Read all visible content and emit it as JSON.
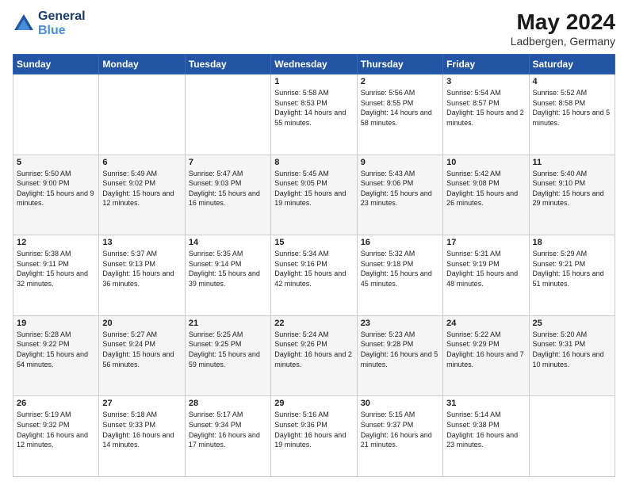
{
  "logo": {
    "line1": "General",
    "line2": "Blue"
  },
  "title": "May 2024",
  "location": "Ladbergen, Germany",
  "days_header": [
    "Sunday",
    "Monday",
    "Tuesday",
    "Wednesday",
    "Thursday",
    "Friday",
    "Saturday"
  ],
  "weeks": [
    [
      {
        "day": "",
        "sunrise": "",
        "sunset": "",
        "daylight": ""
      },
      {
        "day": "",
        "sunrise": "",
        "sunset": "",
        "daylight": ""
      },
      {
        "day": "",
        "sunrise": "",
        "sunset": "",
        "daylight": ""
      },
      {
        "day": "1",
        "sunrise": "Sunrise: 5:58 AM",
        "sunset": "Sunset: 8:53 PM",
        "daylight": "Daylight: 14 hours and 55 minutes."
      },
      {
        "day": "2",
        "sunrise": "Sunrise: 5:56 AM",
        "sunset": "Sunset: 8:55 PM",
        "daylight": "Daylight: 14 hours and 58 minutes."
      },
      {
        "day": "3",
        "sunrise": "Sunrise: 5:54 AM",
        "sunset": "Sunset: 8:57 PM",
        "daylight": "Daylight: 15 hours and 2 minutes."
      },
      {
        "day": "4",
        "sunrise": "Sunrise: 5:52 AM",
        "sunset": "Sunset: 8:58 PM",
        "daylight": "Daylight: 15 hours and 5 minutes."
      }
    ],
    [
      {
        "day": "5",
        "sunrise": "Sunrise: 5:50 AM",
        "sunset": "Sunset: 9:00 PM",
        "daylight": "Daylight: 15 hours and 9 minutes."
      },
      {
        "day": "6",
        "sunrise": "Sunrise: 5:49 AM",
        "sunset": "Sunset: 9:02 PM",
        "daylight": "Daylight: 15 hours and 12 minutes."
      },
      {
        "day": "7",
        "sunrise": "Sunrise: 5:47 AM",
        "sunset": "Sunset: 9:03 PM",
        "daylight": "Daylight: 15 hours and 16 minutes."
      },
      {
        "day": "8",
        "sunrise": "Sunrise: 5:45 AM",
        "sunset": "Sunset: 9:05 PM",
        "daylight": "Daylight: 15 hours and 19 minutes."
      },
      {
        "day": "9",
        "sunrise": "Sunrise: 5:43 AM",
        "sunset": "Sunset: 9:06 PM",
        "daylight": "Daylight: 15 hours and 23 minutes."
      },
      {
        "day": "10",
        "sunrise": "Sunrise: 5:42 AM",
        "sunset": "Sunset: 9:08 PM",
        "daylight": "Daylight: 15 hours and 26 minutes."
      },
      {
        "day": "11",
        "sunrise": "Sunrise: 5:40 AM",
        "sunset": "Sunset: 9:10 PM",
        "daylight": "Daylight: 15 hours and 29 minutes."
      }
    ],
    [
      {
        "day": "12",
        "sunrise": "Sunrise: 5:38 AM",
        "sunset": "Sunset: 9:11 PM",
        "daylight": "Daylight: 15 hours and 32 minutes."
      },
      {
        "day": "13",
        "sunrise": "Sunrise: 5:37 AM",
        "sunset": "Sunset: 9:13 PM",
        "daylight": "Daylight: 15 hours and 36 minutes."
      },
      {
        "day": "14",
        "sunrise": "Sunrise: 5:35 AM",
        "sunset": "Sunset: 9:14 PM",
        "daylight": "Daylight: 15 hours and 39 minutes."
      },
      {
        "day": "15",
        "sunrise": "Sunrise: 5:34 AM",
        "sunset": "Sunset: 9:16 PM",
        "daylight": "Daylight: 15 hours and 42 minutes."
      },
      {
        "day": "16",
        "sunrise": "Sunrise: 5:32 AM",
        "sunset": "Sunset: 9:18 PM",
        "daylight": "Daylight: 15 hours and 45 minutes."
      },
      {
        "day": "17",
        "sunrise": "Sunrise: 5:31 AM",
        "sunset": "Sunset: 9:19 PM",
        "daylight": "Daylight: 15 hours and 48 minutes."
      },
      {
        "day": "18",
        "sunrise": "Sunrise: 5:29 AM",
        "sunset": "Sunset: 9:21 PM",
        "daylight": "Daylight: 15 hours and 51 minutes."
      }
    ],
    [
      {
        "day": "19",
        "sunrise": "Sunrise: 5:28 AM",
        "sunset": "Sunset: 9:22 PM",
        "daylight": "Daylight: 15 hours and 54 minutes."
      },
      {
        "day": "20",
        "sunrise": "Sunrise: 5:27 AM",
        "sunset": "Sunset: 9:24 PM",
        "daylight": "Daylight: 15 hours and 56 minutes."
      },
      {
        "day": "21",
        "sunrise": "Sunrise: 5:25 AM",
        "sunset": "Sunset: 9:25 PM",
        "daylight": "Daylight: 15 hours and 59 minutes."
      },
      {
        "day": "22",
        "sunrise": "Sunrise: 5:24 AM",
        "sunset": "Sunset: 9:26 PM",
        "daylight": "Daylight: 16 hours and 2 minutes."
      },
      {
        "day": "23",
        "sunrise": "Sunrise: 5:23 AM",
        "sunset": "Sunset: 9:28 PM",
        "daylight": "Daylight: 16 hours and 5 minutes."
      },
      {
        "day": "24",
        "sunrise": "Sunrise: 5:22 AM",
        "sunset": "Sunset: 9:29 PM",
        "daylight": "Daylight: 16 hours and 7 minutes."
      },
      {
        "day": "25",
        "sunrise": "Sunrise: 5:20 AM",
        "sunset": "Sunset: 9:31 PM",
        "daylight": "Daylight: 16 hours and 10 minutes."
      }
    ],
    [
      {
        "day": "26",
        "sunrise": "Sunrise: 5:19 AM",
        "sunset": "Sunset: 9:32 PM",
        "daylight": "Daylight: 16 hours and 12 minutes."
      },
      {
        "day": "27",
        "sunrise": "Sunrise: 5:18 AM",
        "sunset": "Sunset: 9:33 PM",
        "daylight": "Daylight: 16 hours and 14 minutes."
      },
      {
        "day": "28",
        "sunrise": "Sunrise: 5:17 AM",
        "sunset": "Sunset: 9:34 PM",
        "daylight": "Daylight: 16 hours and 17 minutes."
      },
      {
        "day": "29",
        "sunrise": "Sunrise: 5:16 AM",
        "sunset": "Sunset: 9:36 PM",
        "daylight": "Daylight: 16 hours and 19 minutes."
      },
      {
        "day": "30",
        "sunrise": "Sunrise: 5:15 AM",
        "sunset": "Sunset: 9:37 PM",
        "daylight": "Daylight: 16 hours and 21 minutes."
      },
      {
        "day": "31",
        "sunrise": "Sunrise: 5:14 AM",
        "sunset": "Sunset: 9:38 PM",
        "daylight": "Daylight: 16 hours and 23 minutes."
      },
      {
        "day": "",
        "sunrise": "",
        "sunset": "",
        "daylight": ""
      }
    ]
  ]
}
